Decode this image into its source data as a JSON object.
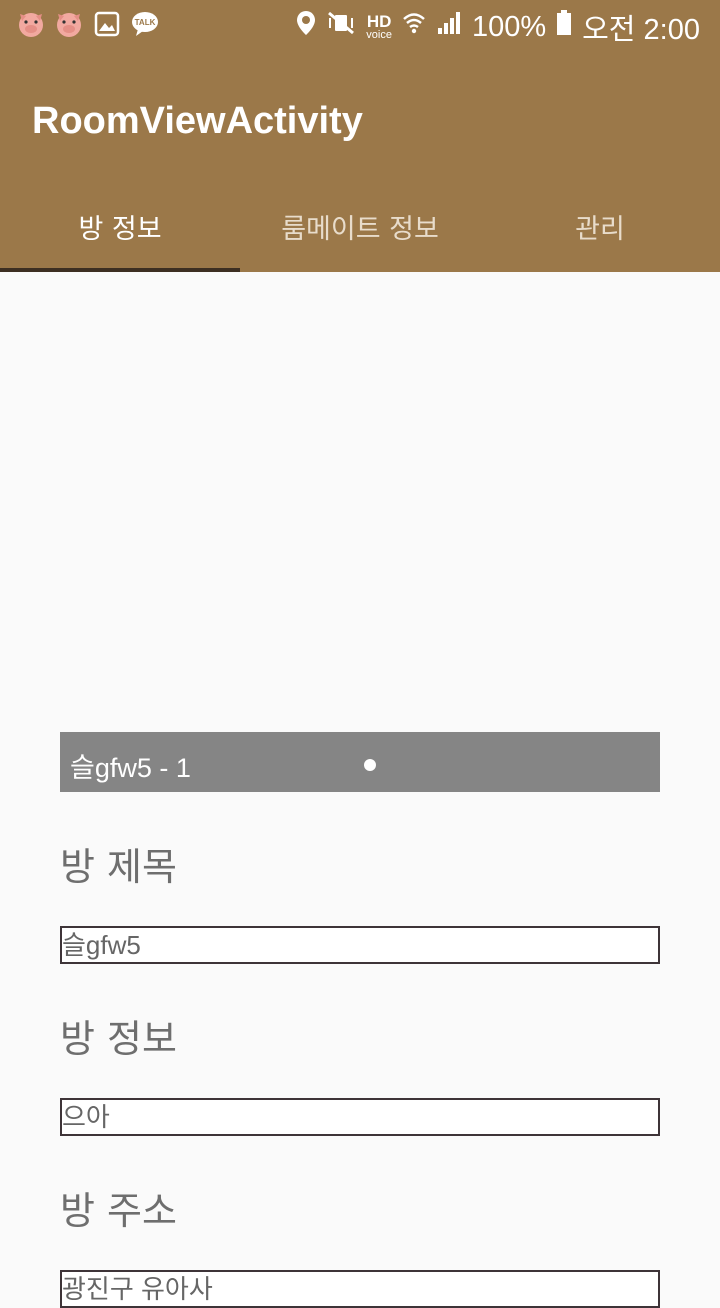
{
  "status_bar": {
    "battery": "100%",
    "time": "오전 2:00",
    "hd_label": "HD",
    "voice_label": "voice",
    "talk_label": "TALK"
  },
  "app": {
    "title": "RoomViewActivity",
    "accent_color": "#9b7849"
  },
  "tabs": [
    {
      "label": "방 정보",
      "active": true
    },
    {
      "label": "룸메이트 정보",
      "active": false
    },
    {
      "label": "관리",
      "active": false
    }
  ],
  "slider": {
    "caption": "슬gfw5 - 1"
  },
  "form": {
    "room_title_label": "방 제목",
    "room_title_value": "슬gfw5",
    "room_info_label": "방 정보",
    "room_info_value": "으아",
    "room_address_label": "방 주소",
    "room_address_value": "광진구 유아사"
  }
}
